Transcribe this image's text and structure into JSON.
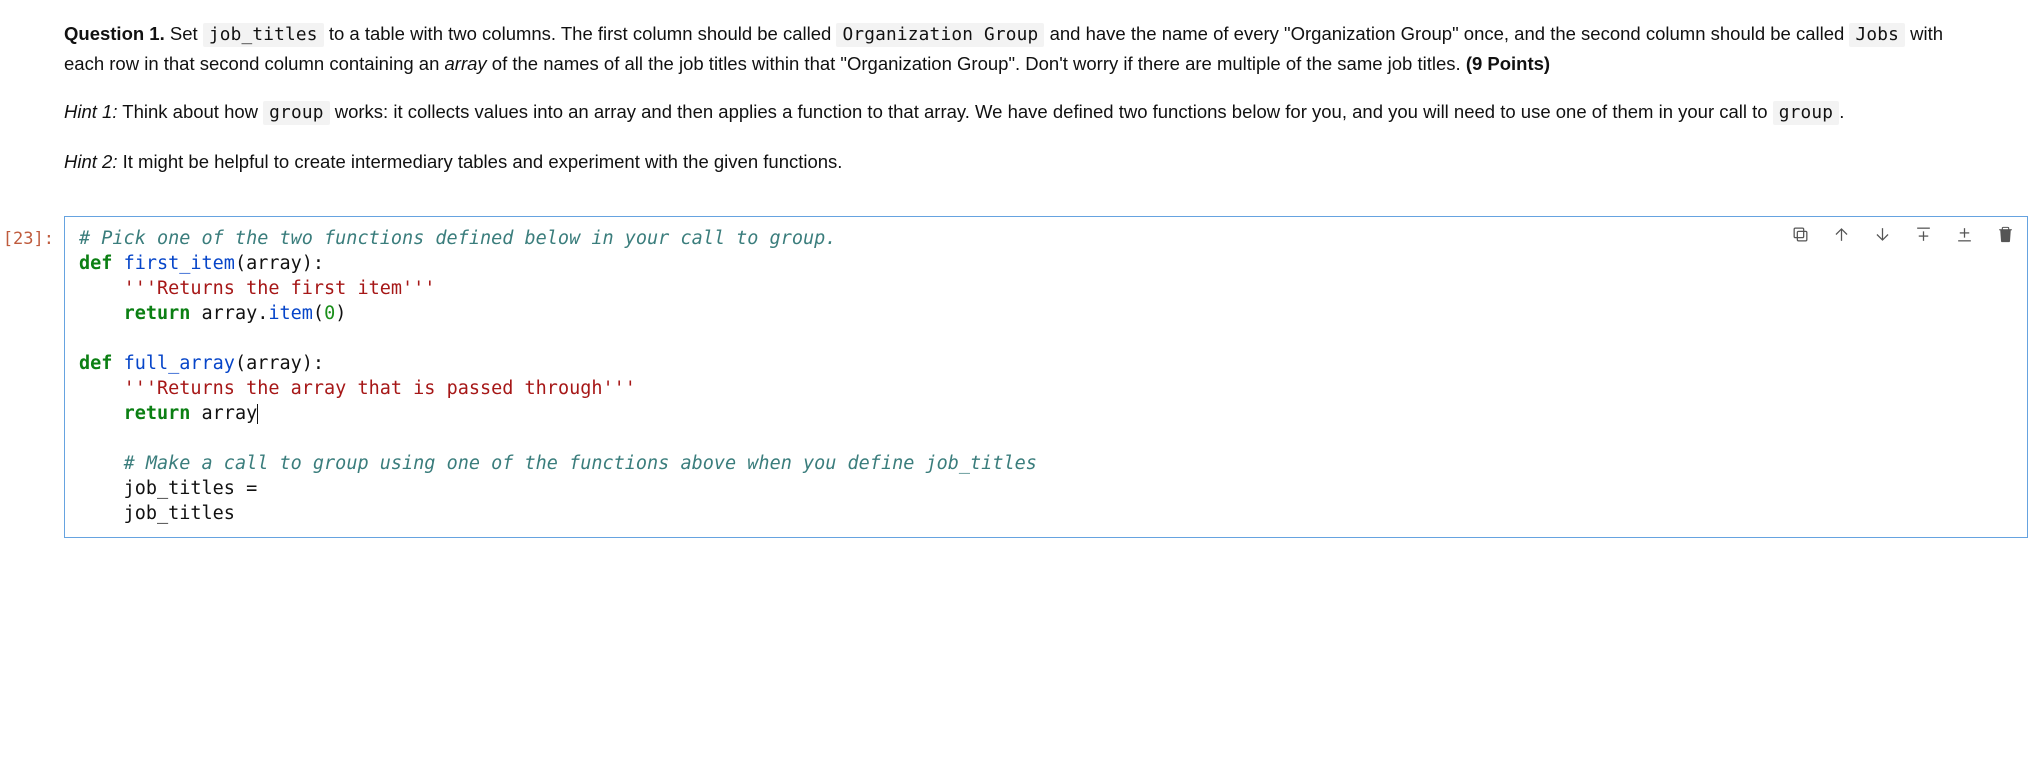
{
  "question": {
    "label": "Question 1.",
    "pre_code_text": "Set ",
    "code1": "job_titles",
    "mid1": " to a table with two columns. The first column should be called ",
    "code2": "Organization Group",
    "mid2": " and have the name of every \"Organization Group\" once, and the second column should be called ",
    "code3": "Jobs",
    "mid3": " with each row in that second column containing an ",
    "em1": "array",
    "mid4": " of the names of all the job titles within that \"Organization Group\". Don't worry if there are multiple of the same job titles. ",
    "points": "(9 Points)"
  },
  "hint1": {
    "label": "Hint 1:",
    "pre": " Think about how ",
    "code1": "group",
    "mid1": " works: it collects values into an array and then applies a function to that array. We have defined two functions below for you, and you will need to use one of them in your call to ",
    "code2": "group",
    "post": "."
  },
  "hint2": {
    "label": "Hint 2:",
    "text": " It might be helpful to create intermediary tables and experiment with the given functions."
  },
  "cell": {
    "prompt": "[23]:",
    "code": {
      "c1": "# Pick one of the two functions defined below in your call to group.",
      "kw_def": "def",
      "fn1": "first_item",
      "fn1_sig": "(array):",
      "doc1": "'''Returns the first item'''",
      "kw_return": "return",
      "ret1_a": " array.",
      "ret1_call": "item",
      "ret1_b": "(",
      "ret1_num": "0",
      "ret1_c": ")",
      "fn2": "full_array",
      "fn2_sig": "(array):",
      "doc2": "'''Returns the array that is passed through'''",
      "ret2": " array",
      "c2": "# Make a call to group using one of the functions above when you define job_titles",
      "l1": "job_titles = ",
      "l2": "job_titles"
    }
  },
  "toolbar": {
    "duplicate": "Duplicate cell",
    "move_up": "Move cell up",
    "move_down": "Move cell down",
    "insert_above": "Insert cell above",
    "insert_below": "Insert cell below",
    "delete": "Delete cell"
  }
}
